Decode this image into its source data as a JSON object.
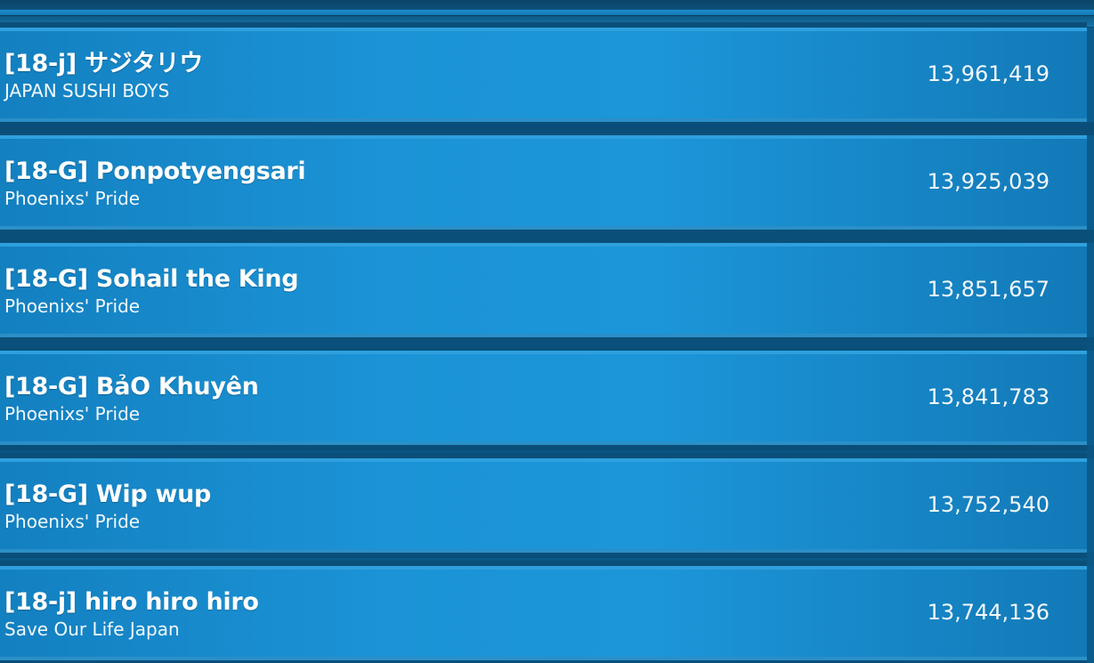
{
  "leaderboard": {
    "rows": [
      {
        "player": "[18-j] サジタリウ",
        "team": "JAPAN SUSHI BOYS",
        "score": "13,961,419"
      },
      {
        "player": "[18-G] Ponpotyengsari",
        "team": "Phoenixs' Pride",
        "score": "13,925,039"
      },
      {
        "player": "[18-G] Sohail the King",
        "team": "Phoenixs' Pride",
        "score": "13,851,657"
      },
      {
        "player": "[18-G] BảO Khuyên",
        "team": "Phoenixs' Pride",
        "score": "13,841,783"
      },
      {
        "player": "[18-G] Wip wup",
        "team": "Phoenixs' Pride",
        "score": "13,752,540"
      },
      {
        "player": "[18-j] hiro hiro hiro",
        "team": "Save Our Life Japan",
        "score": "13,744,136"
      }
    ]
  },
  "colors": {
    "row_fill": "#1b93d6",
    "row_border": "#2fa0de",
    "background": "#0b5a8a",
    "text": "#ffffff"
  }
}
